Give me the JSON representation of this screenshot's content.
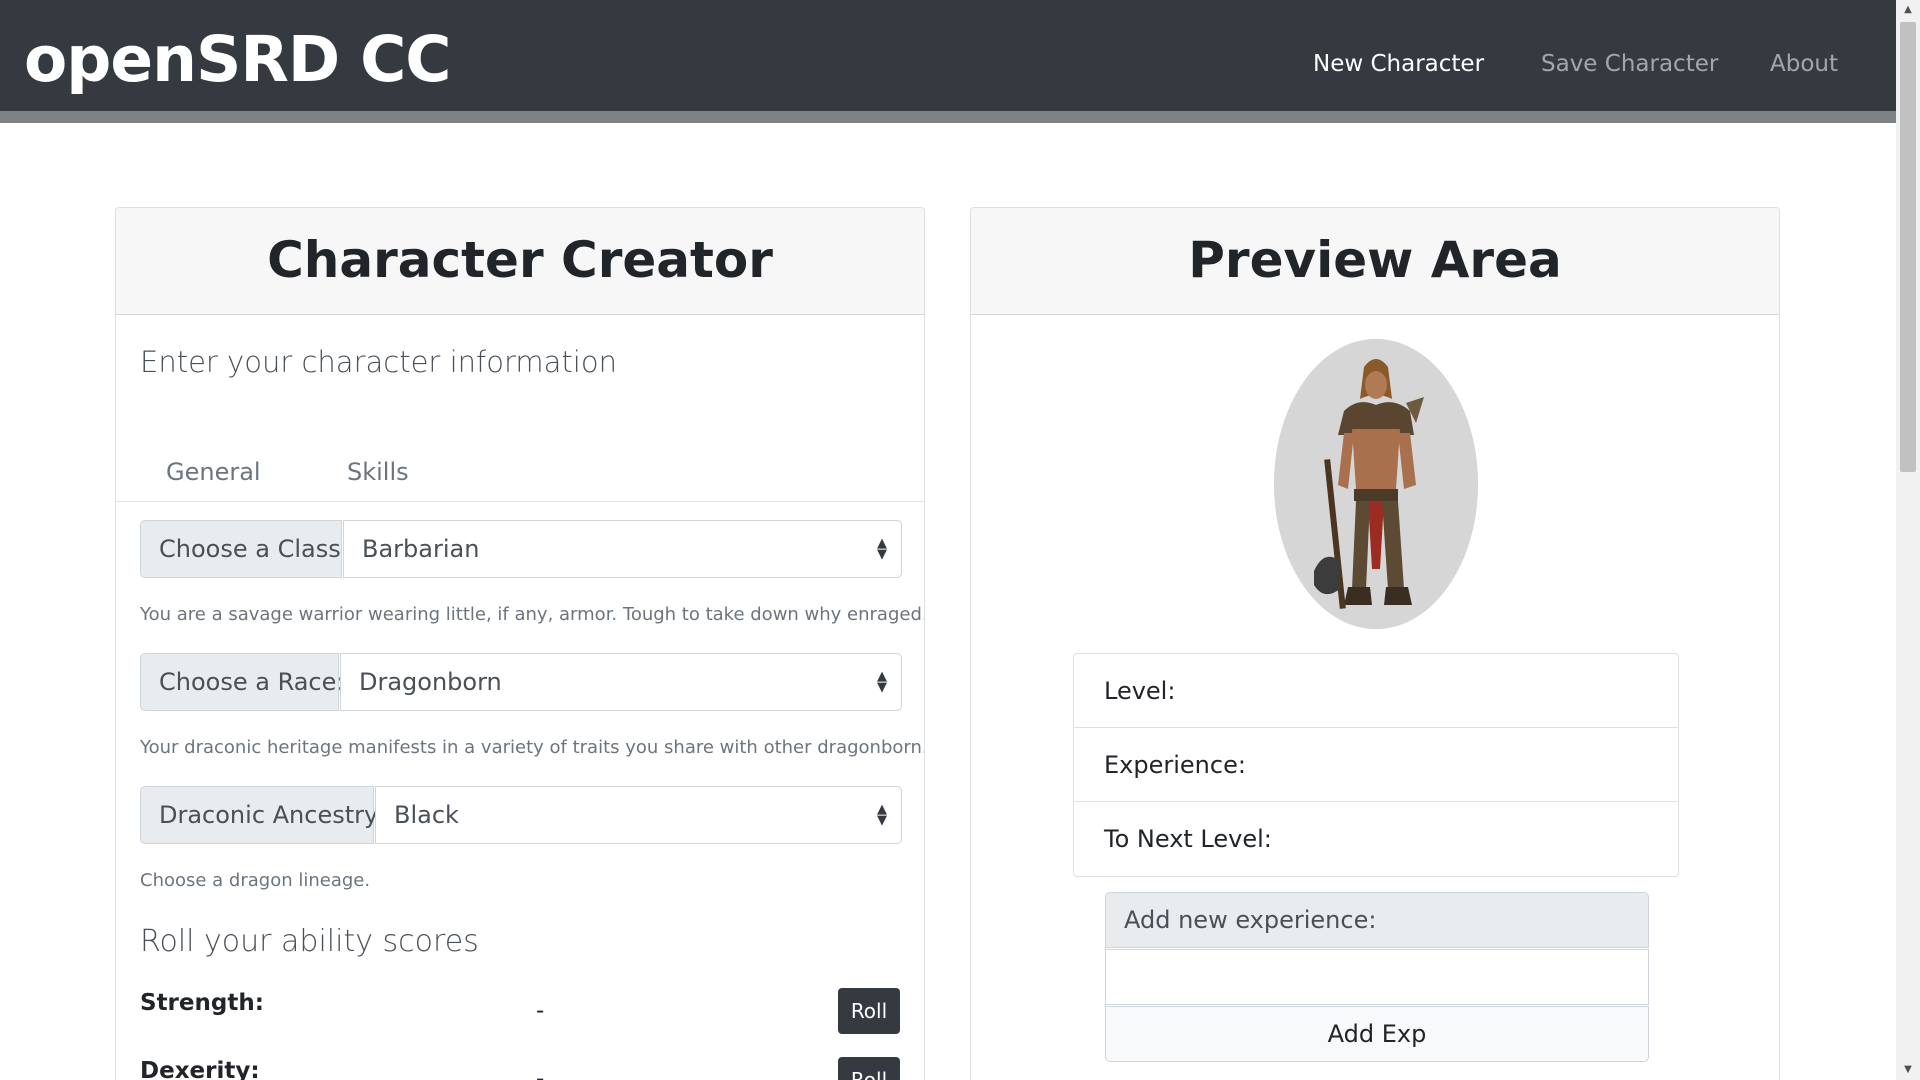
{
  "navbar": {
    "brand": "openSRD CC",
    "links": [
      "New Character",
      "Save Character",
      "About"
    ]
  },
  "creator": {
    "title": "Character Creator",
    "subtitle": "Enter your character information",
    "tabs": [
      "General",
      "Skills"
    ],
    "class": {
      "label": "Choose a Class:",
      "value": "Barbarian",
      "help": "You are a savage warrior wearing little, if any, armor. Tough to take down why enraged."
    },
    "race": {
      "label": "Choose a Race:",
      "value": "Dragonborn",
      "help": "Your draconic heritage manifests in a variety of traits you share with other dragonborn."
    },
    "ancestry": {
      "label": "Draconic Ancestry:",
      "value": "Black",
      "help": "Choose a dragon lineage."
    },
    "abilities_title": "Roll your ability scores",
    "abilities": [
      {
        "label": "Strength:",
        "value": "-",
        "button": "Roll"
      },
      {
        "label": "Dexerity:",
        "value": "-",
        "button": "Roll"
      }
    ]
  },
  "preview": {
    "title": "Preview Area",
    "stats": [
      "Level:",
      "Experience:",
      "To Next Level:"
    ],
    "add_exp_label": "Add new experience:",
    "add_exp_value": "",
    "add_exp_button": "Add Exp"
  },
  "colors": {
    "navbar": "#343a40",
    "button_dark": "#343a40",
    "input_addon": "#e9ecef"
  }
}
